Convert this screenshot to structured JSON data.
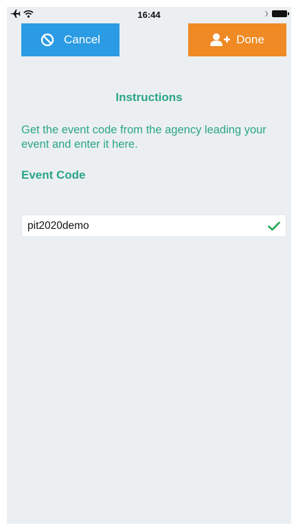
{
  "status_bar": {
    "time": "16:44",
    "left_icons": [
      "airplane-icon",
      "wifi-icon"
    ],
    "right_icons": [
      "moon-icon",
      "battery-icon"
    ]
  },
  "toolbar": {
    "cancel_label": "Cancel",
    "cancel_icon": "no-entry-icon",
    "done_label": "Done",
    "done_icon": "add-user-icon",
    "cancel_color": "#2b9be3",
    "done_color": "#ef8a24"
  },
  "content": {
    "instructions_title": "Instructions",
    "instructions_text": "Get the event code from the agency leading your event and enter it here.",
    "event_code_label": "Event Code",
    "event_code_value": "pit2020demo",
    "event_code_valid_icon": "check-icon",
    "accent_color": "#2aa58a",
    "valid_color": "#2eaa5c"
  }
}
